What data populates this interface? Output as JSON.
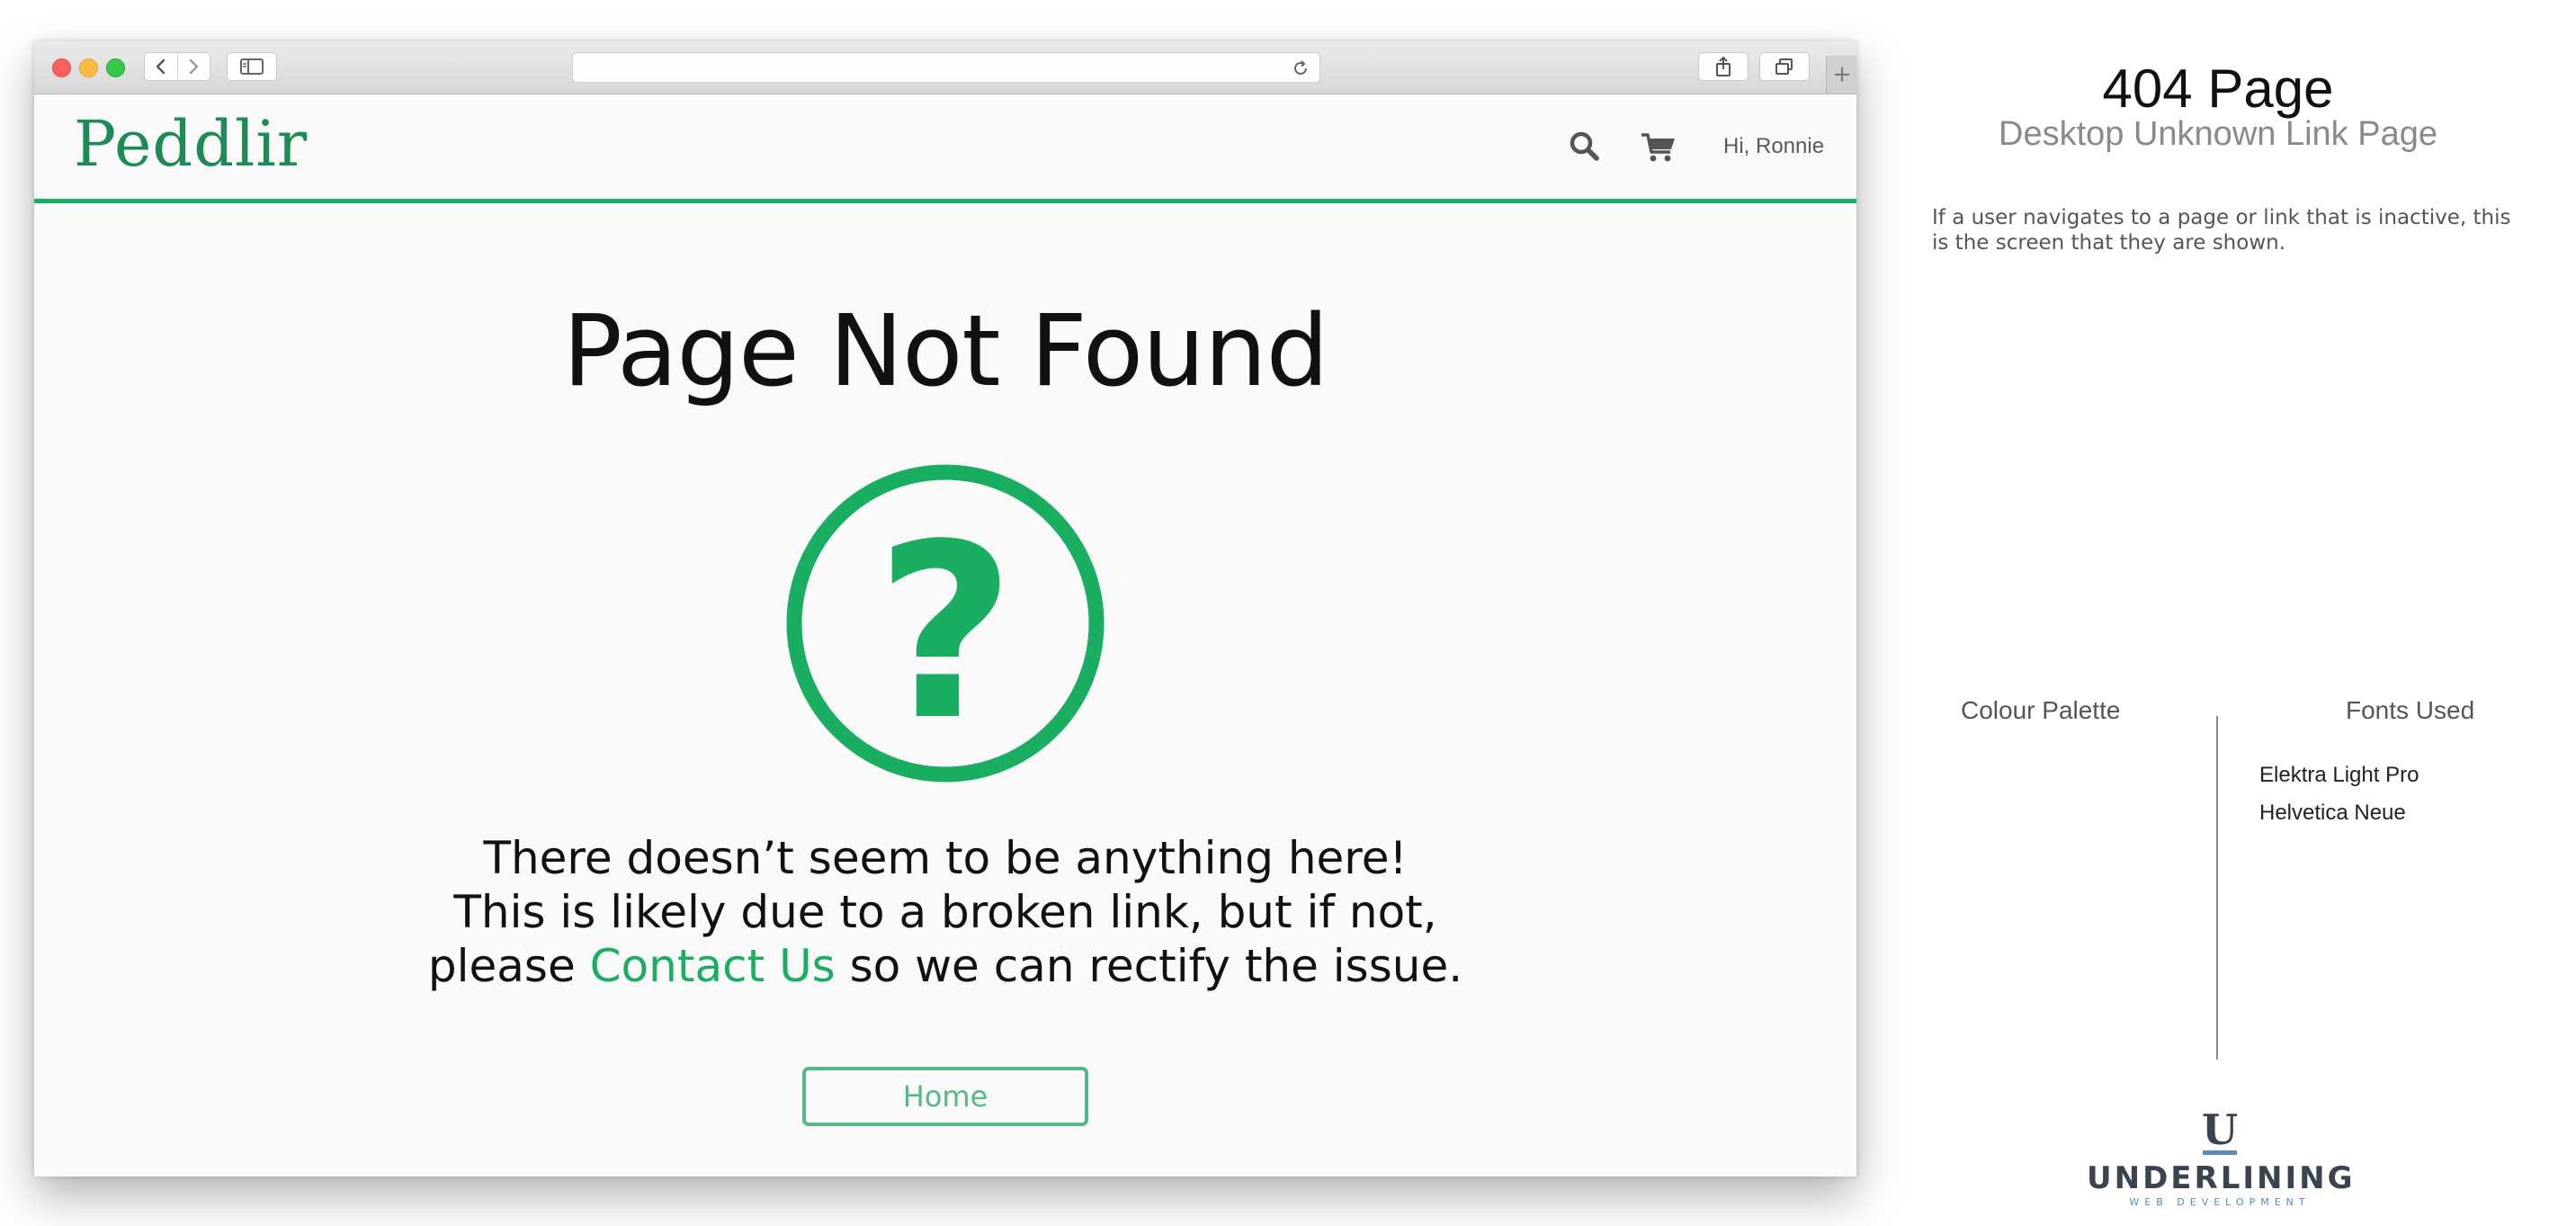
{
  "browser": {
    "newtab_symbol": "+"
  },
  "header": {
    "brand": "Peddlir",
    "greeting": "Hi, Ronnie"
  },
  "main": {
    "title": "Page Not Found",
    "message_line1": "There doesn’t seem to be anything here!",
    "message_line2": "This is likely due to a broken link, but if not,",
    "message_line3_before": "please ",
    "message_link": "Contact Us",
    "message_line3_after": " so we can rectify the issue.",
    "home_button": "Home"
  },
  "annotation": {
    "title": "404 Page",
    "subtitle": "Desktop Unknown Link Page",
    "description": "If a user navigates to a page or link that is inactive, this is the screen that they are shown.",
    "palette_heading": "Colour Palette",
    "fonts_heading": "Fonts Used",
    "fonts": [
      "Elektra Light Pro",
      "Helvetica Neue"
    ]
  },
  "logo": {
    "mark": "U",
    "word": "UNDERLINING",
    "tagline": "WEB DEVELOPMENT"
  },
  "colors": {
    "accent_green": "#1aae63",
    "brand_green": "#1d8b53",
    "button_green": "#55b985"
  },
  "icons": [
    "search-icon",
    "cart-icon",
    "question-circle-icon",
    "back-icon",
    "forward-icon",
    "sidebar-icon",
    "reload-icon",
    "share-icon",
    "tabs-icon"
  ]
}
